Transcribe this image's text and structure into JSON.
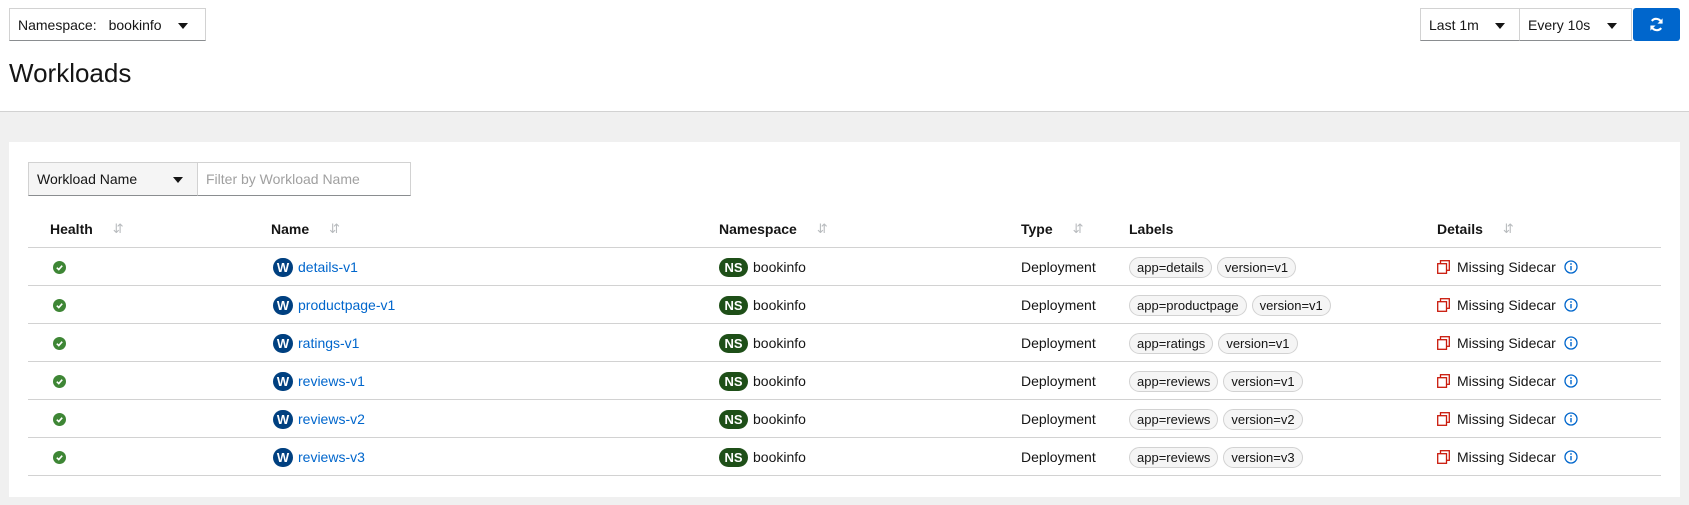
{
  "toolbar": {
    "namespace_label": "Namespace:",
    "namespace_value": "bookinfo",
    "time_range": "Last 1m",
    "refresh_interval": "Every 10s"
  },
  "page_title": "Workloads",
  "filter": {
    "field": "Workload Name",
    "placeholder": "Filter by Workload Name"
  },
  "table": {
    "headers": {
      "health": "Health",
      "name": "Name",
      "namespace": "Namespace",
      "type": "Type",
      "labels": "Labels",
      "details": "Details"
    },
    "rows": [
      {
        "name": "details-v1",
        "namespace": "bookinfo",
        "type": "Deployment",
        "labels": [
          "app=details",
          "version=v1"
        ],
        "details": "Missing Sidecar"
      },
      {
        "name": "productpage-v1",
        "namespace": "bookinfo",
        "type": "Deployment",
        "labels": [
          "app=productpage",
          "version=v1"
        ],
        "details": "Missing Sidecar"
      },
      {
        "name": "ratings-v1",
        "namespace": "bookinfo",
        "type": "Deployment",
        "labels": [
          "app=ratings",
          "version=v1"
        ],
        "details": "Missing Sidecar"
      },
      {
        "name": "reviews-v1",
        "namespace": "bookinfo",
        "type": "Deployment",
        "labels": [
          "app=reviews",
          "version=v1"
        ],
        "details": "Missing Sidecar"
      },
      {
        "name": "reviews-v2",
        "namespace": "bookinfo",
        "type": "Deployment",
        "labels": [
          "app=reviews",
          "version=v2"
        ],
        "details": "Missing Sidecar"
      },
      {
        "name": "reviews-v3",
        "namespace": "bookinfo",
        "type": "Deployment",
        "labels": [
          "app=reviews",
          "version=v3"
        ],
        "details": "Missing Sidecar"
      }
    ]
  },
  "badges": {
    "workload": "W",
    "namespace": "NS"
  },
  "icons": {
    "health": "check-circle-icon",
    "details": "missing-sidecar-icon",
    "info": "info-circle-icon",
    "refresh": "refresh-icon",
    "sort": "sort-icon"
  },
  "colors": {
    "accent": "#0066cc",
    "healthy": "#3e8635",
    "workload_badge": "#004080",
    "namespace_badge": "#1e4f18",
    "warning_red": "#c9190b"
  }
}
